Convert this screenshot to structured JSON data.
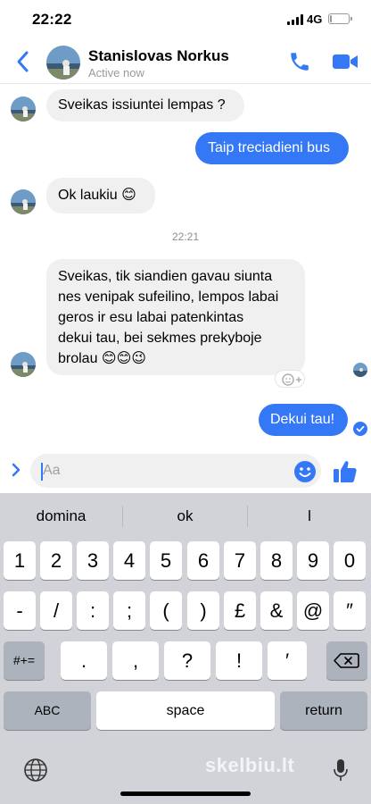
{
  "status_bar": {
    "time": "22:22",
    "network": "4G"
  },
  "header": {
    "contact_name": "Stanislovas Norkus",
    "contact_status": "Active now"
  },
  "messages": [
    {
      "direction": "in",
      "lines": [
        "Sveikas issiuntei lempas ?"
      ]
    },
    {
      "direction": "out",
      "lines": [
        "Taip treciadieni bus"
      ]
    },
    {
      "direction": "in",
      "lines": [
        "Ok laukiu 😊"
      ]
    },
    {
      "direction": "in",
      "lines": [
        "Sveikas, tik siandien gavau siunta",
        "nes venipak sufeilino, lempos labai",
        "geros ir esu labai patenkintas",
        "dekui tau, bei sekmes prekyboje",
        "brolau 😊😊😉"
      ]
    },
    {
      "direction": "out",
      "lines": [
        "Dekui tau!"
      ]
    }
  ],
  "timestamp": "22:21",
  "composer": {
    "placeholder": "Aa"
  },
  "keyboard": {
    "predictions": [
      "domina",
      "ok",
      "l"
    ],
    "row1": [
      "1",
      "2",
      "3",
      "4",
      "5",
      "6",
      "7",
      "8",
      "9",
      "0"
    ],
    "row2": [
      "-",
      "/",
      ":",
      ";",
      "(",
      ")",
      "£",
      "&",
      "@",
      "″"
    ],
    "row3_left": "#+=",
    "row3": [
      ".",
      ",",
      "?",
      "!",
      "′"
    ],
    "abc_label": "ABC",
    "space_label": "space",
    "return_label": "return"
  },
  "watermark": "skelbiu.lt",
  "colors": {
    "accent": "#3478f6",
    "incoming_bubble": "#f0f0f0",
    "keyboard_bg": "#d1d3d9"
  }
}
